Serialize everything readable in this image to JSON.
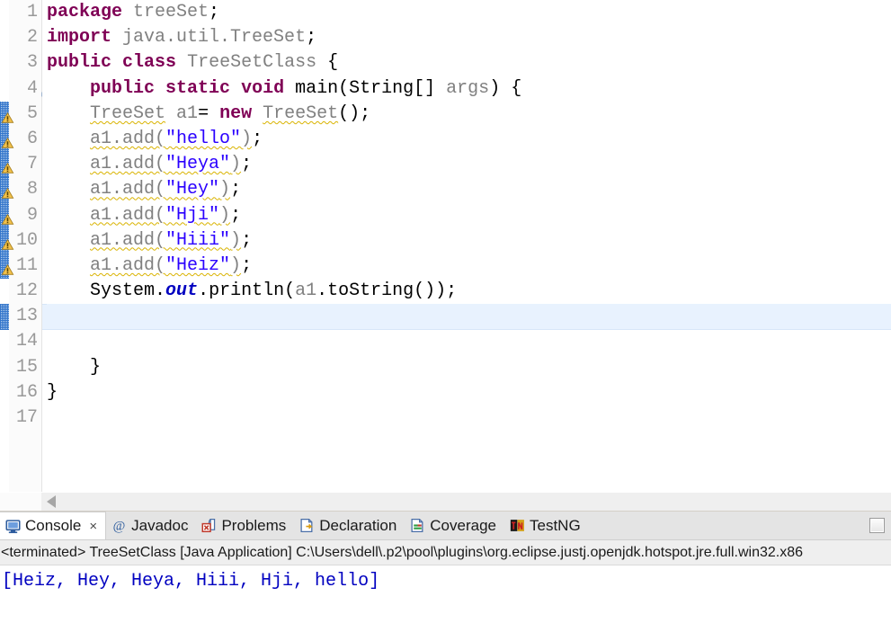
{
  "editor": {
    "lines": [
      {
        "n": "1",
        "warn": false,
        "fold": false,
        "current": false,
        "tokens": [
          {
            "t": "package",
            "c": "kw"
          },
          {
            "t": " ",
            "c": "plain"
          },
          {
            "t": "treeSet",
            "c": "id"
          },
          {
            "t": ";",
            "c": "plain"
          }
        ]
      },
      {
        "n": "2",
        "warn": false,
        "fold": false,
        "current": false,
        "tokens": [
          {
            "t": "import",
            "c": "kw"
          },
          {
            "t": " ",
            "c": "plain"
          },
          {
            "t": "java.util.TreeSet",
            "c": "id"
          },
          {
            "t": ";",
            "c": "plain"
          }
        ]
      },
      {
        "n": "3",
        "warn": false,
        "fold": false,
        "current": false,
        "tokens": [
          {
            "t": "public",
            "c": "kw"
          },
          {
            "t": " ",
            "c": "plain"
          },
          {
            "t": "class",
            "c": "kw"
          },
          {
            "t": " ",
            "c": "plain"
          },
          {
            "t": "TreeSetClass",
            "c": "id"
          },
          {
            "t": " {",
            "c": "plain"
          }
        ]
      },
      {
        "n": "4",
        "warn": false,
        "fold": true,
        "current": false,
        "tokens": [
          {
            "t": "    ",
            "c": "plain"
          },
          {
            "t": "public",
            "c": "kw"
          },
          {
            "t": " ",
            "c": "plain"
          },
          {
            "t": "static",
            "c": "kw"
          },
          {
            "t": " ",
            "c": "plain"
          },
          {
            "t": "void",
            "c": "kw"
          },
          {
            "t": " ",
            "c": "plain"
          },
          {
            "t": "main",
            "c": "plain"
          },
          {
            "t": "(",
            "c": "plain"
          },
          {
            "t": "String",
            "c": "plain"
          },
          {
            "t": "[] ",
            "c": "plain"
          },
          {
            "t": "args",
            "c": "id"
          },
          {
            "t": ") {",
            "c": "plain"
          }
        ]
      },
      {
        "n": "5",
        "warn": true,
        "fold": false,
        "current": false,
        "tokens": [
          {
            "t": "    ",
            "c": "plain"
          },
          {
            "t": "TreeSet",
            "c": "id squiggle"
          },
          {
            "t": " ",
            "c": "plain"
          },
          {
            "t": "a1",
            "c": "id"
          },
          {
            "t": "= ",
            "c": "plain"
          },
          {
            "t": "new",
            "c": "kw"
          },
          {
            "t": " ",
            "c": "plain"
          },
          {
            "t": "TreeSet",
            "c": "id squiggle"
          },
          {
            "t": "();",
            "c": "plain"
          }
        ]
      },
      {
        "n": "6",
        "warn": true,
        "fold": false,
        "current": false,
        "tokens": [
          {
            "t": "    ",
            "c": "plain"
          },
          {
            "t": "a1.add(",
            "c": "id squiggle"
          },
          {
            "t": "\"hello\"",
            "c": "str squiggle"
          },
          {
            "t": ")",
            "c": "id squiggle"
          },
          {
            "t": ";",
            "c": "plain"
          }
        ]
      },
      {
        "n": "7",
        "warn": true,
        "fold": false,
        "current": false,
        "tokens": [
          {
            "t": "    ",
            "c": "plain"
          },
          {
            "t": "a1.add(",
            "c": "id squiggle"
          },
          {
            "t": "\"Heya\"",
            "c": "str squiggle"
          },
          {
            "t": ")",
            "c": "id squiggle"
          },
          {
            "t": ";",
            "c": "plain"
          }
        ]
      },
      {
        "n": "8",
        "warn": true,
        "fold": false,
        "current": false,
        "tokens": [
          {
            "t": "    ",
            "c": "plain"
          },
          {
            "t": "a1.add(",
            "c": "id squiggle"
          },
          {
            "t": "\"Hey\"",
            "c": "str squiggle"
          },
          {
            "t": ")",
            "c": "id squiggle"
          },
          {
            "t": ";",
            "c": "plain"
          }
        ]
      },
      {
        "n": "9",
        "warn": true,
        "fold": false,
        "current": false,
        "tokens": [
          {
            "t": "    ",
            "c": "plain"
          },
          {
            "t": "a1.add(",
            "c": "id squiggle"
          },
          {
            "t": "\"Hji\"",
            "c": "str squiggle"
          },
          {
            "t": ")",
            "c": "id squiggle"
          },
          {
            "t": ";",
            "c": "plain"
          }
        ]
      },
      {
        "n": "10",
        "warn": true,
        "fold": false,
        "current": false,
        "tokens": [
          {
            "t": "    ",
            "c": "plain"
          },
          {
            "t": "a1.add(",
            "c": "id squiggle"
          },
          {
            "t": "\"Hiii\"",
            "c": "str squiggle"
          },
          {
            "t": ")",
            "c": "id squiggle"
          },
          {
            "t": ";",
            "c": "plain"
          }
        ]
      },
      {
        "n": "11",
        "warn": true,
        "fold": false,
        "current": false,
        "tokens": [
          {
            "t": "    ",
            "c": "plain"
          },
          {
            "t": "a1.add(",
            "c": "id squiggle"
          },
          {
            "t": "\"Heiz\"",
            "c": "str squiggle"
          },
          {
            "t": ")",
            "c": "id squiggle"
          },
          {
            "t": ";",
            "c": "plain"
          }
        ]
      },
      {
        "n": "12",
        "warn": false,
        "fold": false,
        "current": false,
        "tokens": [
          {
            "t": "    ",
            "c": "plain"
          },
          {
            "t": "System",
            "c": "plain"
          },
          {
            "t": ".",
            "c": "plain"
          },
          {
            "t": "out",
            "c": "field"
          },
          {
            "t": ".println(",
            "c": "plain"
          },
          {
            "t": "a1",
            "c": "id"
          },
          {
            "t": ".toString());",
            "c": "plain"
          }
        ]
      },
      {
        "n": "13",
        "warn": false,
        "fold": false,
        "current": true,
        "tokens": []
      },
      {
        "n": "14",
        "warn": false,
        "fold": false,
        "current": false,
        "tokens": []
      },
      {
        "n": "15",
        "warn": false,
        "fold": false,
        "current": false,
        "tokens": [
          {
            "t": "    }",
            "c": "plain"
          }
        ]
      },
      {
        "n": "16",
        "warn": false,
        "fold": false,
        "current": false,
        "tokens": [
          {
            "t": "}",
            "c": "plain"
          }
        ]
      },
      {
        "n": "17",
        "warn": false,
        "fold": false,
        "current": false,
        "tokens": []
      }
    ],
    "scrollbar": {
      "arrow_icon": "scroll-left-arrow-icon"
    }
  },
  "console_view": {
    "tabs": [
      {
        "label": "Console",
        "icon": "console-monitor-icon",
        "active": true,
        "closable": true
      },
      {
        "label": "Javadoc",
        "icon": "javadoc-at-icon",
        "active": false,
        "closable": false
      },
      {
        "label": "Problems",
        "icon": "problems-icon",
        "active": false,
        "closable": false
      },
      {
        "label": "Declaration",
        "icon": "declaration-icon",
        "active": false,
        "closable": false
      },
      {
        "label": "Coverage",
        "icon": "coverage-icon",
        "active": false,
        "closable": false
      },
      {
        "label": "TestNG",
        "icon": "testng-icon",
        "active": false,
        "closable": false
      }
    ],
    "close_glyph": "×",
    "minimize_button": "minimize-view-button",
    "status_line": "<terminated> TreeSetClass [Java Application] C:\\Users\\dell\\.p2\\pool\\plugins\\org.eclipse.justj.openjdk.hotspot.jre.full.win32.x86",
    "output": "[Heiz, Hey, Heya, Hiii, Hji, hello]"
  },
  "colors": {
    "keyword": "#7f0055",
    "string": "#2a00ff",
    "identifier": "#808080",
    "static_field": "#0000c0",
    "console_text": "#0000c0",
    "current_line": "#e8f2fe",
    "warning_squiggle": "#d9b300",
    "annotation_mark": "#2a6fc9",
    "tabbar_bg": "#e4e4e4",
    "status_bg": "#efefef"
  }
}
